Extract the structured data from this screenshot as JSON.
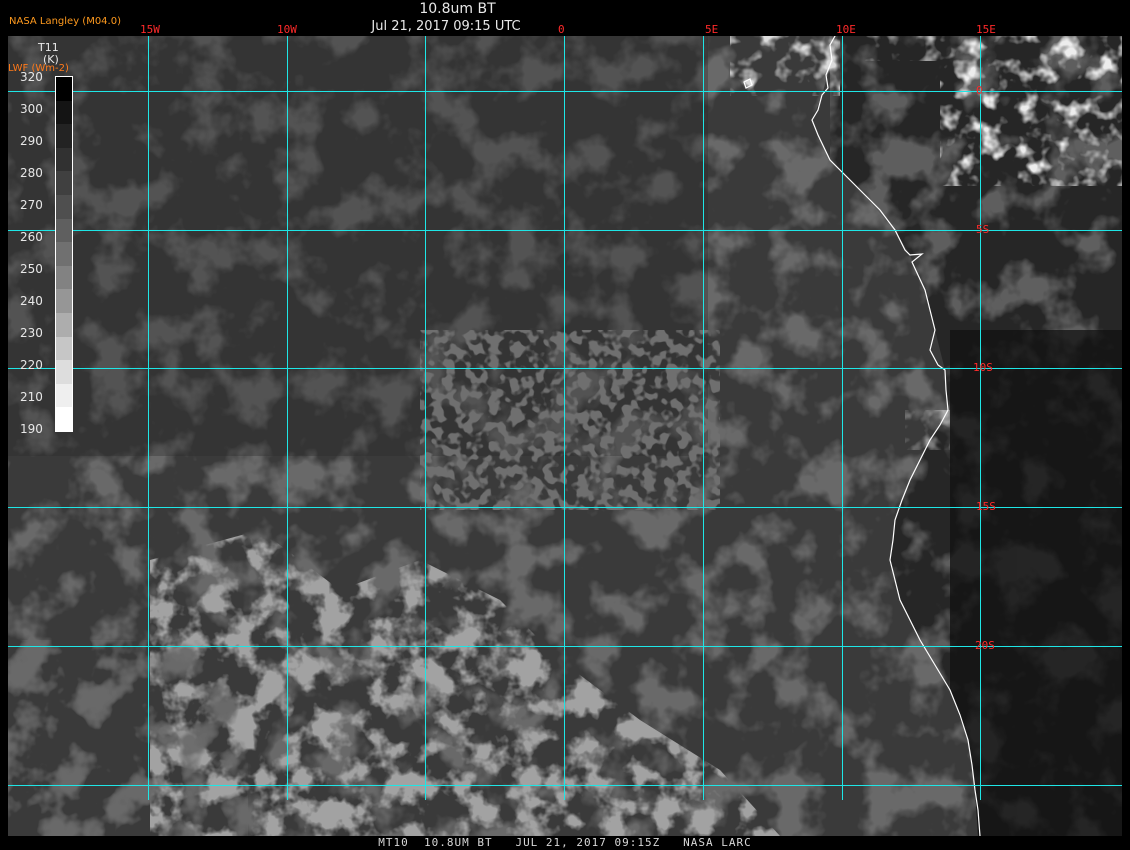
{
  "header": {
    "title": "10.8um BT",
    "datetime": "Jul 21, 2017 09:15 UTC",
    "credit": "NASA Langley (M04.0)"
  },
  "colorbar": {
    "variable": "T11",
    "unit": "(K)",
    "overlay_label": "LWF (Wm-2)",
    "ticks": [
      "320",
      "300",
      "290",
      "280",
      "270",
      "260",
      "250",
      "240",
      "230",
      "220",
      "210",
      "190"
    ],
    "band_colors": [
      "#000000",
      "#141414",
      "#232323",
      "#313131",
      "#404040",
      "#4f4f4f",
      "#5f5f5f",
      "#707070",
      "#828282",
      "#969696",
      "#adadad",
      "#c6c6c6",
      "#dddddd",
      "#efefef",
      "#ffffff"
    ]
  },
  "map": {
    "longitude_labels": [
      "15W",
      "10W",
      "0",
      "5E",
      "10E",
      "15E"
    ],
    "latitude_labels": [
      "0",
      "5S",
      "10S",
      "15S",
      "20S"
    ],
    "colors": {
      "grid": "#1ee6e6",
      "grid_label": "#ff2a2a",
      "coastline": "#ffffff",
      "ocean": "#383838",
      "cloud_low": "#242424",
      "cloud_mid": "#5a5a5a",
      "cloud_high": "#c8c8c8",
      "land_warm": "#141414"
    }
  },
  "footer": {
    "text": "MT10  10.8UM BT   JUL 21, 2017 09:15Z   NASA LARC"
  }
}
